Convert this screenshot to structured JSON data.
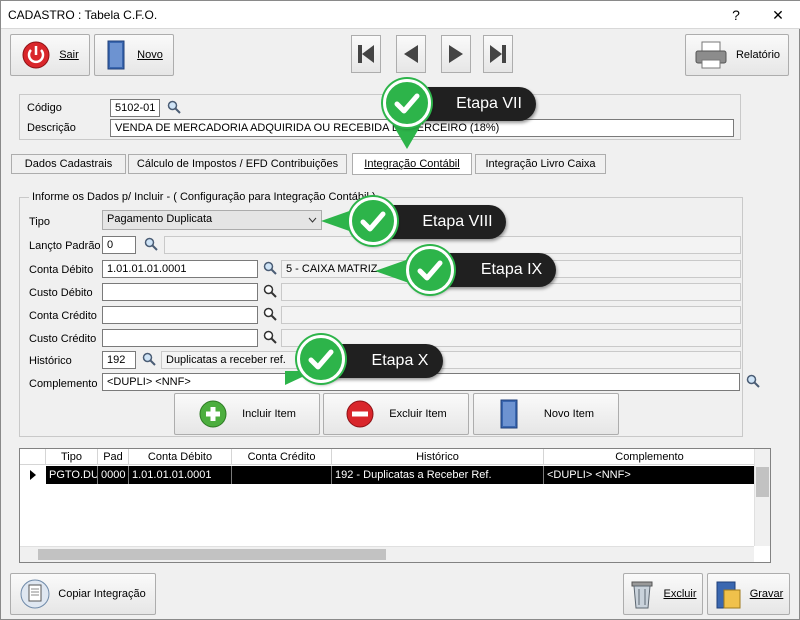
{
  "window": {
    "title": "CADASTRO : Tabela C.F.O.",
    "help": "?",
    "close": "✕"
  },
  "toolbar": {
    "exit_label": "Sair",
    "new_label": "Novo",
    "report_label": "Relatório"
  },
  "header": {
    "code_label": "Código",
    "code_value": "5102-01",
    "description_label": "Descrição",
    "description_value": "VENDA DE MERCADORIA ADQUIRIDA OU RECEBIDA DE TERCEIRO (18%)"
  },
  "tabs": [
    {
      "label": "Dados Cadastrais"
    },
    {
      "label": "Cálculo de Impostos / EFD Contribuições"
    },
    {
      "label": "Integração Contábil"
    },
    {
      "label": "Integração Livro Caixa"
    }
  ],
  "form": {
    "group_title": "Informe os Dados p/ Incluir  - ( Configuração para  Integração  Contábil )",
    "tipo_label": "Tipo",
    "tipo_value": "Pagamento Duplicata",
    "lancto_label": "Lançto Padrão",
    "lancto_value": "0",
    "debit_label": "Conta Débito",
    "debit_value": "1.01.01.01.0001",
    "debit_desc": "5 - CAIXA MATRIZ",
    "cost_debit_label": "Custo Débito",
    "cost_debit_value": "",
    "credit_label": "Conta Crédito",
    "credit_value": "",
    "cost_credit_label": "Custo Crédito",
    "cost_credit_value": "",
    "history_label": "Histórico",
    "history_value": "192",
    "history_desc": "Duplicatas a receber ref.",
    "complement_label": "Complemento",
    "complement_value": "<DUPLI> <NNF>"
  },
  "actions": {
    "include_label": "Incluir Item",
    "delete_label": "Excluir Item",
    "new_item_label": "Novo Item"
  },
  "grid": {
    "columns": [
      "Tipo",
      "Pad",
      "Conta Débito",
      "Conta Crédito",
      "Histórico",
      "Complemento"
    ],
    "rows": [
      {
        "tipo": "PGTO.DU",
        "pad": "0000",
        "debito": "1.01.01.01.0001",
        "credito": "",
        "historico": "192 - Duplicatas a Receber Ref.",
        "complemento": "<DUPLI> <NNF>"
      }
    ]
  },
  "footer": {
    "copy_label": "Copiar Integração",
    "delete_label": "Excluir",
    "save_label": "Gravar"
  },
  "callouts": {
    "etapa7": "Etapa VII",
    "etapa8": "Etapa VIII",
    "etapa9": "Etapa IX",
    "etapa10": "Etapa X"
  },
  "colors": {
    "callout_green": "#2db44a",
    "callout_dark": "#202020",
    "selection": "#000000"
  }
}
